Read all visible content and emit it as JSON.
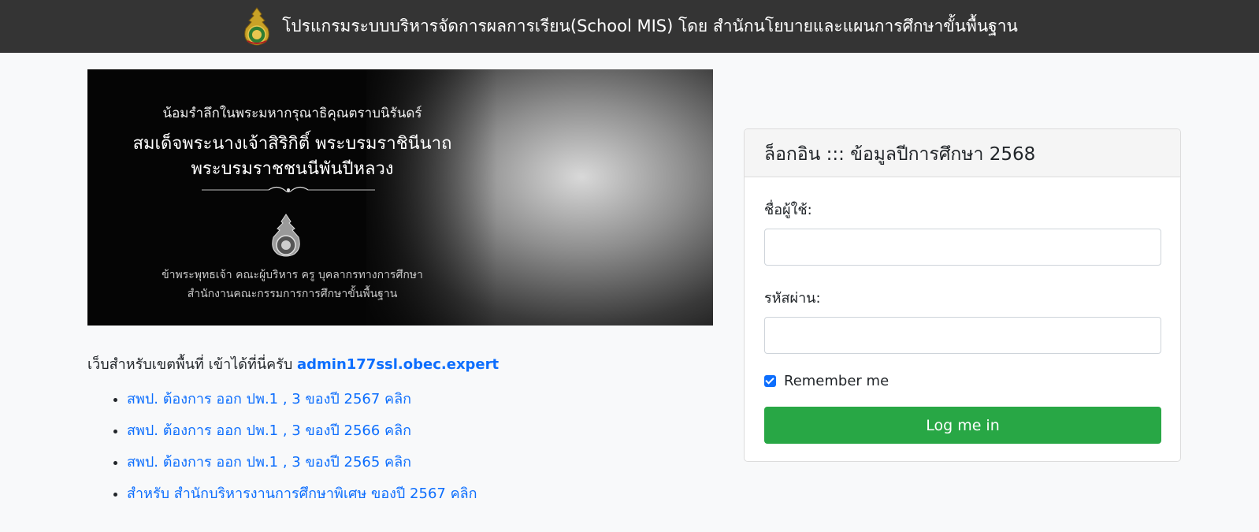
{
  "header": {
    "title": "โปรแกรมระบบบริหารจัดการผลการเรียน(School MIS) โดย สำนักนโยบายและแผนการศึกษาขั้นพื้นฐาน",
    "logo_icon": "obec-emblem-icon"
  },
  "banner": {
    "line1": "น้อมรำลึกในพระมหากรุณาธิคุณตราบนิรันดร์",
    "line2": "สมเด็จพระนางเจ้าสิริกิติ์ พระบรมราชินีนาถ",
    "line3": "พระบรมราชชนนีพันปีหลวง",
    "line4": "ข้าพระพุทธเจ้า คณะผู้บริหาร ครู บุคลากรทางการศึกษา",
    "line5": "สำนักงานคณะกรรมการการศึกษาขั้นพื้นฐาน",
    "emblem_icon": "obec-emblem-icon",
    "ornament_icon": "ornament-divider-icon"
  },
  "notice": {
    "text": "เว็บสำหรับเขตพื้นที่ เข้าได้ที่นี่ครับ ",
    "link": "admin177ssl.obec.expert"
  },
  "links": [
    "สพป. ต้องการ ออก ปพ.1 , 3 ของปี 2567 คลิก",
    "สพป. ต้องการ ออก ปพ.1 , 3 ของปี 2566 คลิก",
    "สพป. ต้องการ ออก ปพ.1 , 3 ของปี 2565 คลิก",
    "สำหรับ สำนักบริหารงานการศึกษาพิเศษ ของปี 2567 คลิก"
  ],
  "login": {
    "title": "ล็อกอิน ::: ข้อมูลปีการศึกษา 2568",
    "username_label": "ชื่อผู้ใช้:",
    "username_value": "",
    "password_label": "รหัสผ่าน:",
    "password_value": "",
    "remember_label": "Remember me",
    "remember_checked": true,
    "button_label": "Log me in"
  },
  "colors": {
    "topbar": "#343434",
    "link": "#0d6efd",
    "button": "#28a745",
    "checkbox": "#0d6efd"
  }
}
